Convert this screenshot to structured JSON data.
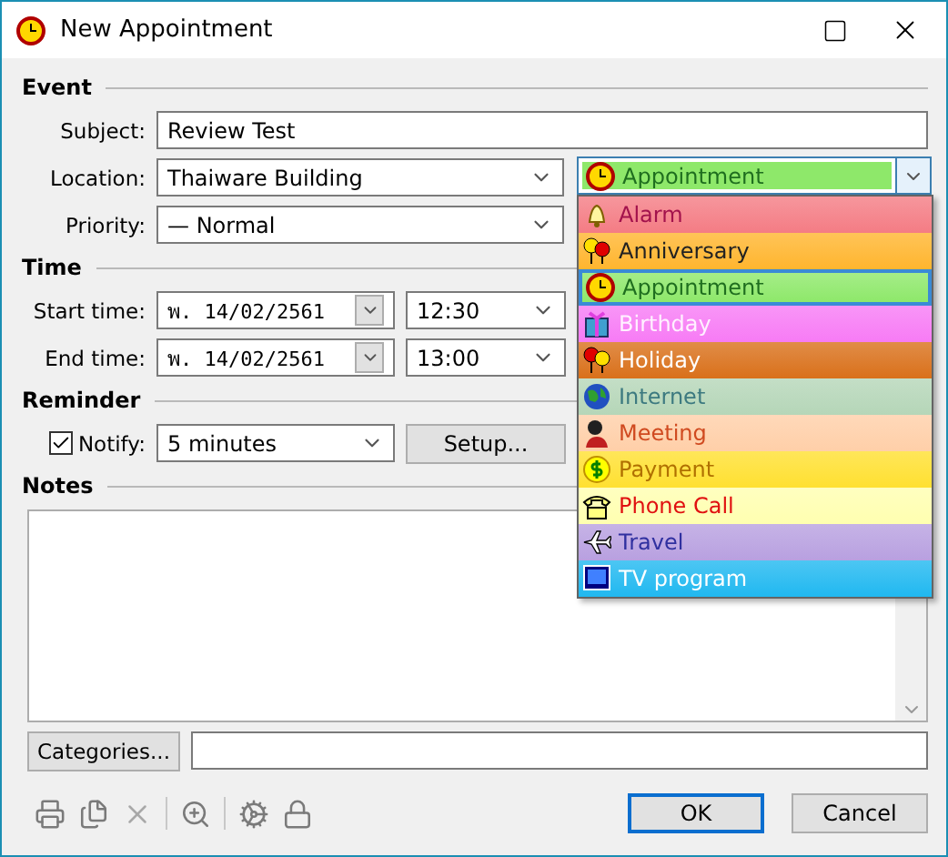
{
  "window": {
    "title": "New Appointment"
  },
  "event": {
    "heading": "Event",
    "subject": {
      "label": "Subject:",
      "value": "Review Test"
    },
    "location": {
      "label": "Location:",
      "value": "Thaiware Building"
    },
    "priority": {
      "label": "Priority:",
      "value": "— Normal"
    }
  },
  "category": {
    "value": "Appointment",
    "kind": "clock",
    "color": "#8ee86a",
    "expanded": true,
    "options": [
      {
        "label": "Alarm",
        "kind": "bell",
        "color": "#f47c84",
        "selected": false
      },
      {
        "label": "Anniversary",
        "kind": "balloons",
        "color": "#ffb52e",
        "selected": false
      },
      {
        "label": "Appointment",
        "kind": "clock",
        "color": "#8ee86a",
        "selected": true
      },
      {
        "label": "Birthday",
        "kind": "gift",
        "color": "#f77bf5",
        "selected": false
      },
      {
        "label": "Holiday",
        "kind": "balloons2",
        "color": "#d9701a",
        "selected": false
      },
      {
        "label": "Internet",
        "kind": "globe",
        "color": "#b5d6b8",
        "selected": false
      },
      {
        "label": "Meeting",
        "kind": "person",
        "color": "#ffcfa8",
        "selected": false
      },
      {
        "label": "Payment",
        "kind": "dollar",
        "color": "#ffe030",
        "selected": false
      },
      {
        "label": "Phone Call",
        "kind": "phone",
        "color": "#ffffb0",
        "selected": false
      },
      {
        "label": "Travel",
        "kind": "plane",
        "color": "#b8a0e0",
        "selected": false
      },
      {
        "label": "TV program",
        "kind": "tv",
        "color": "#20b8f0",
        "selected": false
      }
    ]
  },
  "time": {
    "heading": "Time",
    "start": {
      "label": "Start time:",
      "date": "พ. 14/02/2561",
      "time": "12:30"
    },
    "end": {
      "label": "End time:",
      "date": "พ. 14/02/2561",
      "time": "13:00"
    }
  },
  "reminder": {
    "heading": "Reminder",
    "notify": {
      "label": "Notify:",
      "checked": true,
      "value": "5 minutes"
    },
    "setup": "Setup..."
  },
  "notes": {
    "heading": "Notes"
  },
  "categories_button": "Categories...",
  "toolbar": [
    {
      "kind": "print"
    },
    {
      "kind": "copy"
    },
    {
      "kind": "delete"
    },
    {
      "kind": "separator"
    },
    {
      "kind": "zoom"
    },
    {
      "kind": "separator"
    },
    {
      "kind": "gear"
    },
    {
      "kind": "lock"
    }
  ],
  "buttons": [
    {
      "label": "OK",
      "default": true
    },
    {
      "label": "Cancel",
      "default": false
    }
  ]
}
